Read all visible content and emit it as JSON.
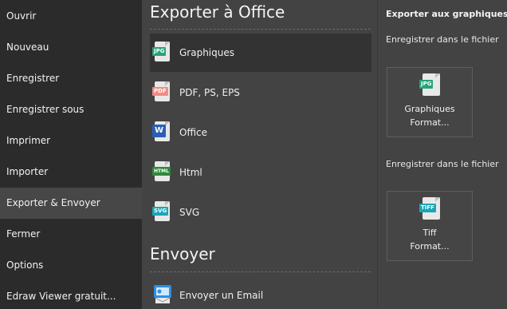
{
  "sidebar": {
    "items": [
      {
        "label": "Ouvrir"
      },
      {
        "label": "Nouveau"
      },
      {
        "label": "Enregistrer"
      },
      {
        "label": "Enregistrer sous"
      },
      {
        "label": "Imprimer"
      },
      {
        "label": "Importer"
      },
      {
        "label": "Exporter & Envoyer",
        "active": true
      },
      {
        "label": "Fermer"
      },
      {
        "label": "Options"
      },
      {
        "label": "Edraw Viewer gratuit..."
      }
    ]
  },
  "middle": {
    "export_title": "Exporter à Office",
    "export_items": [
      {
        "label": "Graphiques",
        "icon": "jpg-file-icon",
        "badge": "JPG",
        "color": "#27a37b"
      },
      {
        "label": "PDF, PS, EPS",
        "icon": "pdf-file-icon",
        "badge": "PDF",
        "color": "#f28b82"
      },
      {
        "label": "Office",
        "icon": "word-file-icon",
        "badge": "W",
        "color": "#2b5fb4"
      },
      {
        "label": "Html",
        "icon": "html-file-icon",
        "badge": "HTML",
        "color": "#2f8a3c"
      },
      {
        "label": "SVG",
        "icon": "svg-file-icon",
        "badge": "SVG",
        "color": "#1aa6b7"
      }
    ],
    "send_title": "Envoyer",
    "send_items": [
      {
        "label": "Envoyer un Email",
        "icon": "email-icon"
      }
    ]
  },
  "right": {
    "heading": "Exporter aux graphiques",
    "sub1": "Enregistrer dans le fichier",
    "btn1": {
      "line1": "Graphiques",
      "line2": "Format...",
      "badge": "JPG",
      "color": "#27a37b"
    },
    "sub2": "Enregistrer dans le fichier",
    "btn2": {
      "line1": "Tiff",
      "line2": "Format...",
      "badge": "TIFF",
      "color": "#1aa6b7"
    }
  }
}
